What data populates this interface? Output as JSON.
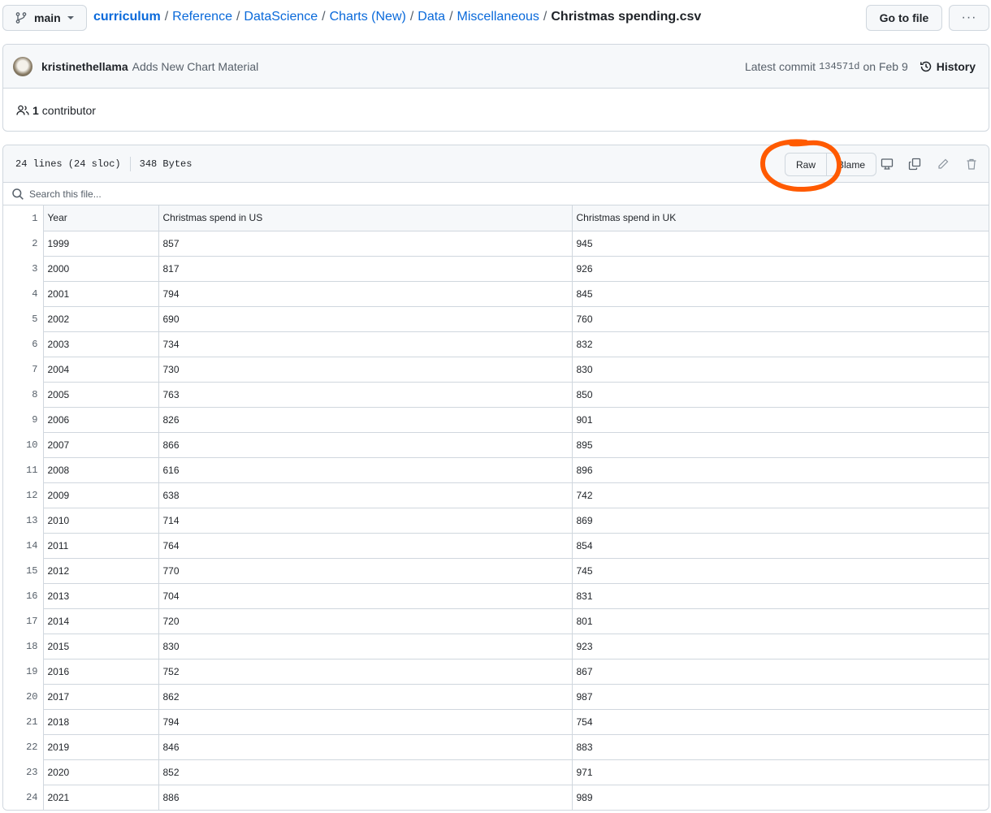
{
  "branch": {
    "name": "main"
  },
  "breadcrumb": {
    "root": "curriculum",
    "parts": [
      "Reference",
      "DataScience",
      "Charts (New)",
      "Data",
      "Miscellaneous"
    ],
    "separator": "/",
    "current": "Christmas spending.csv"
  },
  "toolbar": {
    "goto_file_label": "Go to file",
    "more_label": "···"
  },
  "commit": {
    "author": "kristinethellama",
    "message": "Adds New Chart Material",
    "latest_prefix": "Latest commit",
    "sha": "134571d",
    "date": "on Feb 9",
    "history_label": "History"
  },
  "contributors": {
    "count": "1",
    "label": "contributor"
  },
  "file": {
    "lines_info": "24 lines (24 sloc)",
    "size": "348 Bytes",
    "raw_label": "Raw",
    "blame_label": "Blame",
    "search_placeholder": "Search this file..."
  },
  "annotation": {
    "color": "#ff5a00",
    "target": "Raw"
  },
  "table": {
    "header": {
      "line": "1",
      "cells": [
        "Year",
        "Christmas spend in US",
        "Christmas spend in UK"
      ]
    },
    "rows": [
      {
        "line": "2",
        "cells": [
          "1999",
          "857",
          "945"
        ]
      },
      {
        "line": "3",
        "cells": [
          "2000",
          "817",
          "926"
        ]
      },
      {
        "line": "4",
        "cells": [
          "2001",
          "794",
          "845"
        ]
      },
      {
        "line": "5",
        "cells": [
          "2002",
          "690",
          "760"
        ]
      },
      {
        "line": "6",
        "cells": [
          "2003",
          "734",
          "832"
        ]
      },
      {
        "line": "7",
        "cells": [
          "2004",
          "730",
          "830"
        ]
      },
      {
        "line": "8",
        "cells": [
          "2005",
          "763",
          "850"
        ]
      },
      {
        "line": "9",
        "cells": [
          "2006",
          "826",
          "901"
        ]
      },
      {
        "line": "10",
        "cells": [
          "2007",
          "866",
          "895"
        ]
      },
      {
        "line": "11",
        "cells": [
          "2008",
          "616",
          "896"
        ]
      },
      {
        "line": "12",
        "cells": [
          "2009",
          "638",
          "742"
        ]
      },
      {
        "line": "13",
        "cells": [
          "2010",
          "714",
          "869"
        ]
      },
      {
        "line": "14",
        "cells": [
          "2011",
          "764",
          "854"
        ]
      },
      {
        "line": "15",
        "cells": [
          "2012",
          "770",
          "745"
        ]
      },
      {
        "line": "16",
        "cells": [
          "2013",
          "704",
          "831"
        ]
      },
      {
        "line": "17",
        "cells": [
          "2014",
          "720",
          "801"
        ]
      },
      {
        "line": "18",
        "cells": [
          "2015",
          "830",
          "923"
        ]
      },
      {
        "line": "19",
        "cells": [
          "2016",
          "752",
          "867"
        ]
      },
      {
        "line": "20",
        "cells": [
          "2017",
          "862",
          "987"
        ]
      },
      {
        "line": "21",
        "cells": [
          "2018",
          "794",
          "754"
        ]
      },
      {
        "line": "22",
        "cells": [
          "2019",
          "846",
          "883"
        ]
      },
      {
        "line": "23",
        "cells": [
          "2020",
          "852",
          "971"
        ]
      },
      {
        "line": "24",
        "cells": [
          "2021",
          "886",
          "989"
        ]
      }
    ]
  }
}
